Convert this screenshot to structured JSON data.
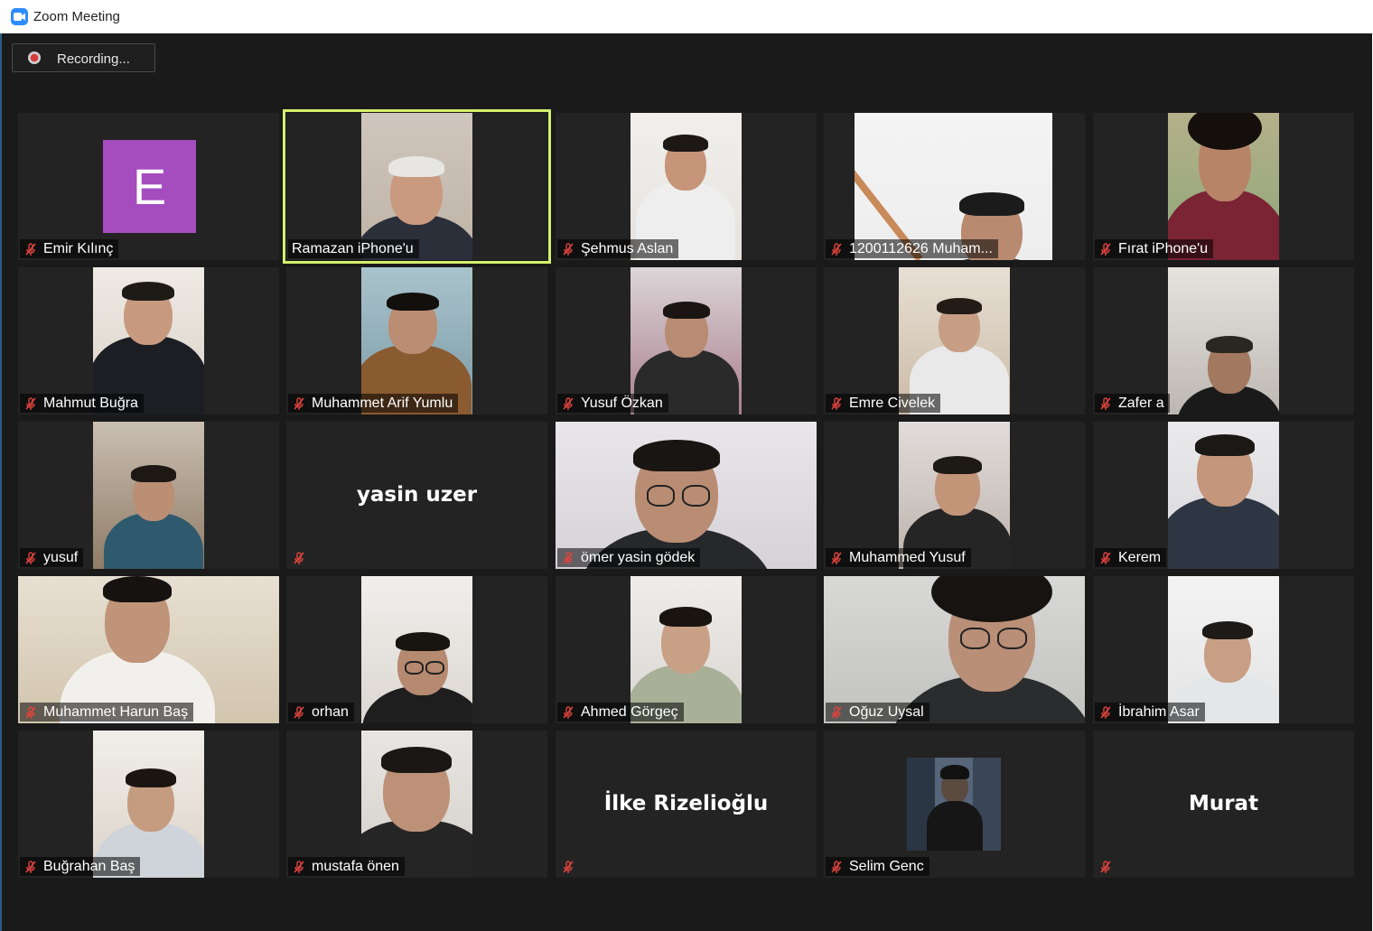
{
  "window": {
    "title": "Zoom Meeting",
    "app_icon": "zoom-camera-icon"
  },
  "recording": {
    "label": "Recording..."
  },
  "colors": {
    "active_speaker": "#d4ee6c",
    "avatar_bg": "#a54cbf",
    "mute_icon": "#e0443e"
  },
  "participants": [
    {
      "name": "Emir Kılınç",
      "avatar_letter": "E",
      "muted": true
    },
    {
      "name": "Ramazan iPhone'u",
      "muted": false,
      "active_speaker": true
    },
    {
      "name": "Şehmus Aslan",
      "muted": true
    },
    {
      "name": "1200112626 Muham...",
      "muted": true
    },
    {
      "name": "Fırat iPhone'u",
      "muted": true
    },
    {
      "name": "Mahmut Buğra",
      "muted": true
    },
    {
      "name": "Muhammet Arif Yumlu",
      "muted": true
    },
    {
      "name": "Yusuf Özkan",
      "muted": true
    },
    {
      "name": "Emre Civelek",
      "muted": true
    },
    {
      "name": "Zafer a",
      "muted": true
    },
    {
      "name": "yusuf",
      "muted": true
    },
    {
      "name": "",
      "center_name": "yasin uzer",
      "muted": true
    },
    {
      "name": "ömer yasin gödek",
      "muted": true
    },
    {
      "name": "Muhammed Yusuf",
      "muted": true
    },
    {
      "name": "Kerem",
      "muted": true
    },
    {
      "name": "Muhammet Harun Baş",
      "muted": true
    },
    {
      "name": "orhan",
      "muted": true
    },
    {
      "name": "Ahmed Görgeç",
      "muted": true
    },
    {
      "name": "Oğuz Uysal",
      "muted": true
    },
    {
      "name": "İbrahim Asar",
      "muted": true
    },
    {
      "name": "Buğrahan Baş",
      "muted": true
    },
    {
      "name": "mustafa önen",
      "muted": true
    },
    {
      "name": "",
      "center_name": "İlke Rizelioğlu",
      "muted": true
    },
    {
      "name": "Selim Genc",
      "muted": true
    },
    {
      "name": "",
      "center_name": "Murat",
      "muted": true
    }
  ]
}
